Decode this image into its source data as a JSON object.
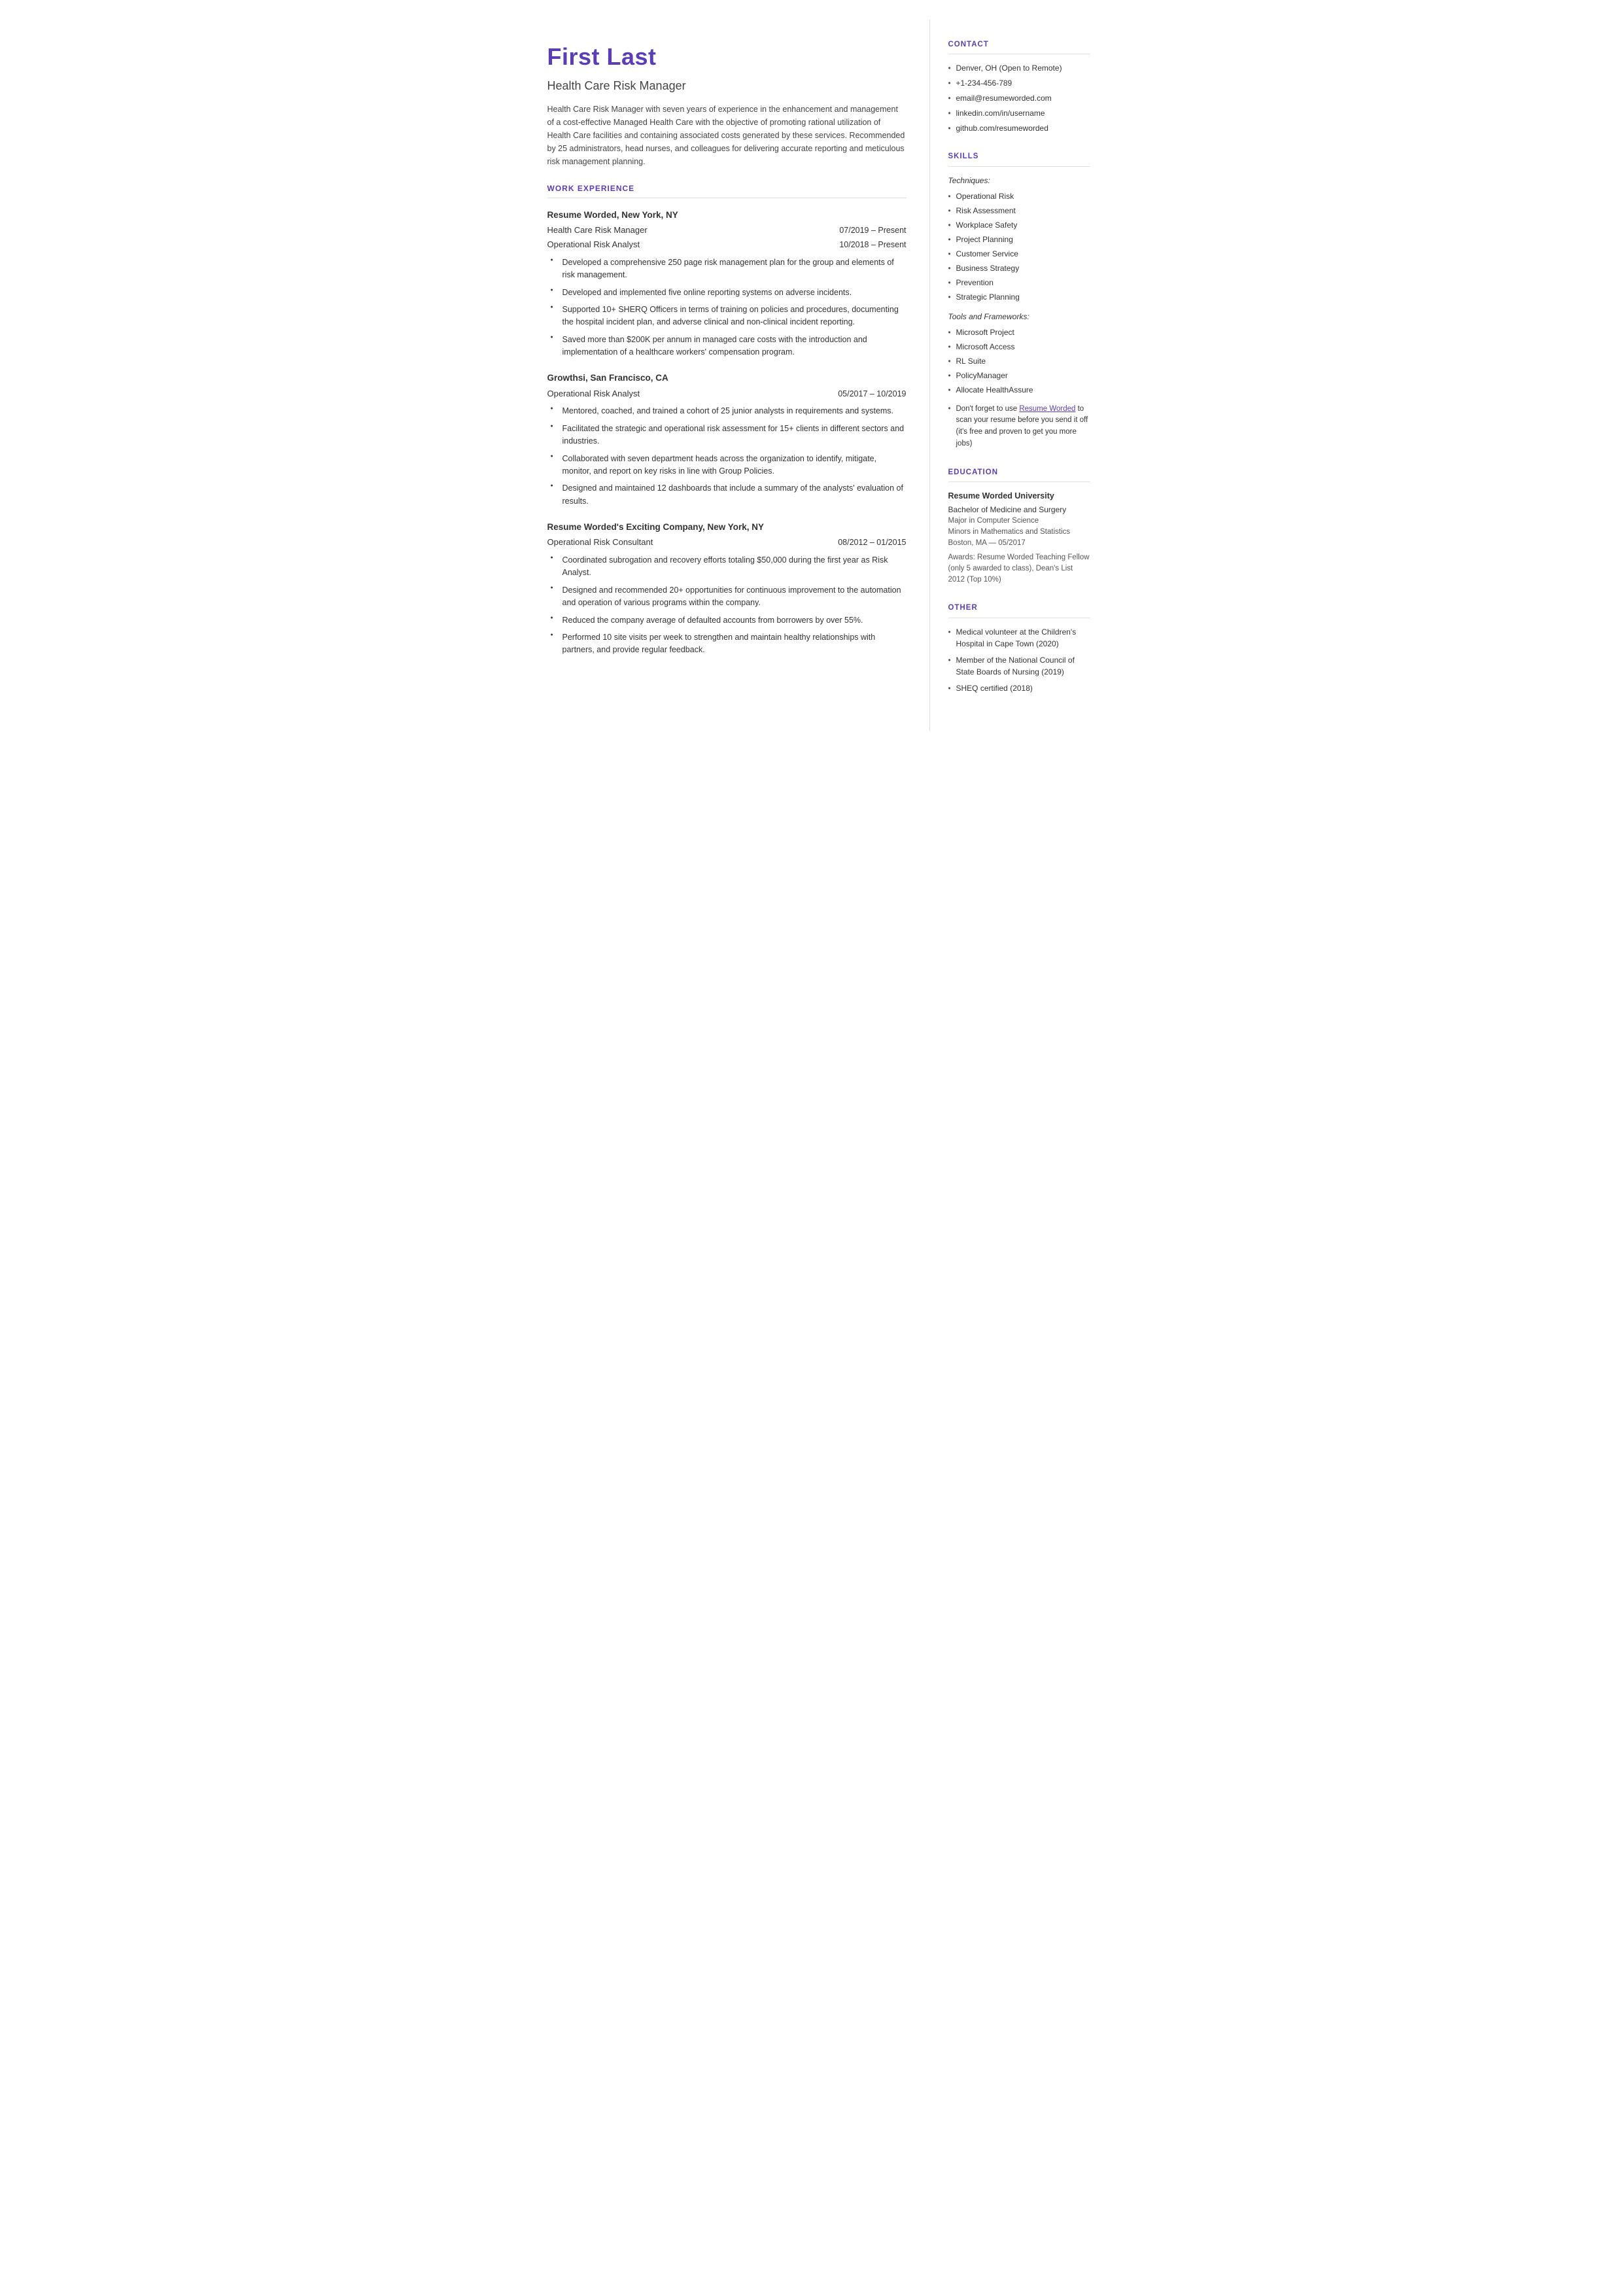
{
  "header": {
    "name": "First Last",
    "job_title": "Health Care Risk Manager",
    "summary": "Health Care Risk Manager with seven years of experience in the enhancement and management of a cost-effective Managed Health Care with the objective of promoting rational utilization of Health Care facilities and containing associated costs generated by these services. Recommended by 25 administrators, head nurses, and colleagues for delivering accurate reporting and meticulous risk management planning."
  },
  "sections": {
    "work_experience_label": "WORK EXPERIENCE",
    "companies": [
      {
        "name": "Resume Worded, New York, NY",
        "roles": [
          {
            "title": "Health Care Risk Manager",
            "dates": "07/2019 – Present"
          },
          {
            "title": "Operational Risk Analyst",
            "dates": "10/2018 – Present"
          }
        ],
        "bullets": [
          "Developed a comprehensive 250 page risk management plan for the group and elements of risk management.",
          "Developed and implemented five online reporting systems on adverse incidents.",
          "Supported 10+ SHERQ Officers in terms of training on policies and procedures, documenting the hospital incident plan, and adverse clinical and non-clinical incident reporting.",
          "Saved more than $200K per annum in managed care costs with the introduction and implementation of a healthcare workers' compensation program."
        ]
      },
      {
        "name": "Growthsi, San Francisco, CA",
        "roles": [
          {
            "title": "Operational Risk Analyst",
            "dates": "05/2017 – 10/2019"
          }
        ],
        "bullets": [
          "Mentored, coached, and trained a cohort of 25 junior analysts in requirements and systems.",
          "Facilitated the strategic and operational risk assessment for 15+ clients in different sectors and industries.",
          "Collaborated with seven department heads across the organization to identify, mitigate, monitor, and report on key risks in line with Group Policies.",
          "Designed and maintained 12 dashboards that include a summary of the analysts' evaluation of results."
        ]
      },
      {
        "name": "Resume Worded's Exciting Company, New York, NY",
        "roles": [
          {
            "title": "Operational Risk Consultant",
            "dates": "08/2012 – 01/2015"
          }
        ],
        "bullets": [
          "Coordinated subrogation and recovery efforts totaling $50,000 during the first year as Risk Analyst.",
          "Designed and recommended 20+ opportunities for continuous improvement to the automation and operation of various programs within the company.",
          "Reduced the company average of defaulted accounts from borrowers by over 55%.",
          "Performed 10 site visits per week to strengthen and maintain healthy relationships with partners, and provide regular feedback."
        ]
      }
    ]
  },
  "right": {
    "contact_label": "CONTACT",
    "contact_items": [
      "Denver, OH (Open to Remote)",
      "+1-234-456-789",
      "email@resumeworded.com",
      "linkedin.com/in/username",
      "github.com/resumeworded"
    ],
    "skills_label": "SKILLS",
    "techniques_label": "Techniques:",
    "techniques": [
      "Operational Risk",
      "Risk Assessment",
      "Workplace Safety",
      "Project Planning",
      "Customer Service",
      "Business Strategy",
      "Prevention",
      "Strategic Planning"
    ],
    "tools_label": "Tools and Frameworks:",
    "tools": [
      "Microsoft Project",
      "Microsoft Access",
      "RL Suite",
      "PolicyManager",
      "Allocate HealthAssure"
    ],
    "resume_worded_note_prefix": "Don't forget to use ",
    "resume_worded_link_text": "Resume Worded",
    "resume_worded_note_suffix": " to scan your resume before you send it off (it's free and proven to get you more jobs)",
    "education_label": "EDUCATION",
    "education": {
      "university": "Resume Worded University",
      "degree": "Bachelor of Medicine and Surgery",
      "major": "Major in Computer Science",
      "minors": "Minors in Mathematics and Statistics",
      "location_date": "Boston, MA — 05/2017",
      "awards": "Awards: Resume Worded Teaching Fellow (only 5 awarded to class), Dean's List 2012 (Top 10%)"
    },
    "other_label": "OTHER",
    "other_items": [
      "Medical volunteer at the Children's Hospital in Cape Town (2020)",
      "Member of the National Council of State Boards of Nursing (2019)",
      "SHEQ certified (2018)"
    ]
  }
}
